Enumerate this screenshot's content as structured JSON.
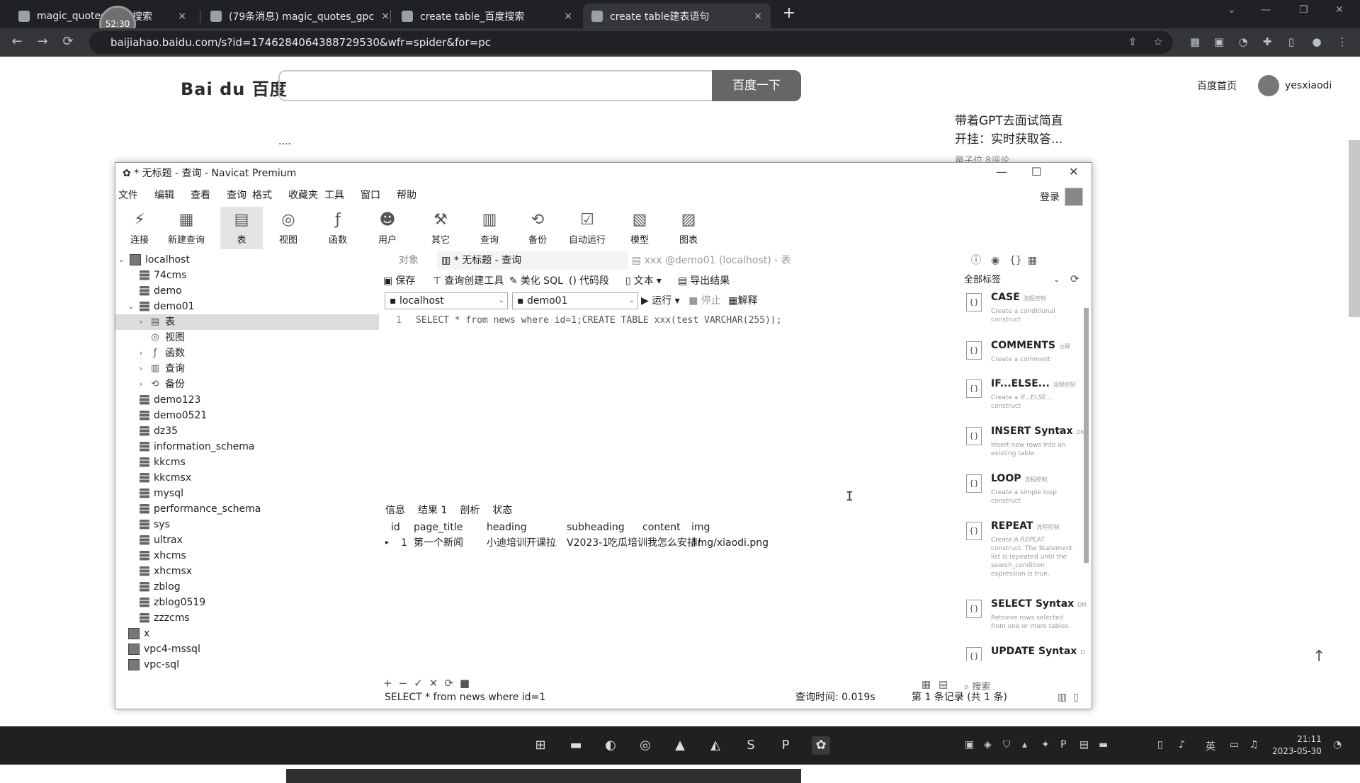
{
  "browser": {
    "tabs": [
      {
        "title": "magic_quotes",
        "close": "×"
      },
      {
        "title": "搜索",
        "close": "×"
      },
      {
        "title": "(79条消息) magic_quotes_gpc",
        "close": "×"
      },
      {
        "title": "create table_百度搜索",
        "close": "×"
      },
      {
        "title": "create table建表语句",
        "close": "×"
      }
    ],
    "new_tab": "+",
    "timer": "52:30",
    "url": "baijiahao.baidu.com/s?id=1746284064388729530&wfr=spider&for=pc",
    "back": "←",
    "forward": "→",
    "reload": "⟳"
  },
  "baidu": {
    "logo": "Bai du 百度",
    "search_value": "",
    "search_button": "百度一下",
    "home_link": "百度首页",
    "username": "yesxiaodi",
    "ellipsis": "....",
    "ad_line1": "带着GPT去面试简直",
    "ad_line2": "开挂：实时获取答...",
    "ad_meta": "量子位  8评论"
  },
  "navicat": {
    "title": "* 无标题 - 查询 - Navicat Premium",
    "menu": [
      "文件",
      "编辑",
      "查看",
      "查询",
      "格式",
      "收藏夹",
      "工具",
      "窗口",
      "帮助"
    ],
    "login": "登录",
    "toolbar": [
      {
        "label": "连接",
        "icon": "plug-icon"
      },
      {
        "label": "新建查询",
        "icon": "new-query-icon"
      },
      {
        "label": "表",
        "icon": "table-icon"
      },
      {
        "label": "视图",
        "icon": "view-icon"
      },
      {
        "label": "函数",
        "icon": "function-icon"
      },
      {
        "label": "用户",
        "icon": "user-icon"
      },
      {
        "label": "其它",
        "icon": "tools-icon"
      },
      {
        "label": "查询",
        "icon": "query-icon"
      },
      {
        "label": "备份",
        "icon": "backup-icon"
      },
      {
        "label": "自动运行",
        "icon": "auto-run-icon"
      },
      {
        "label": "模型",
        "icon": "model-icon"
      },
      {
        "label": "图表",
        "icon": "chart-icon"
      }
    ],
    "tree": {
      "root": "localhost",
      "dbs_before": [
        "74cms",
        "demo"
      ],
      "open_db": "demo01",
      "open_children": [
        "表",
        "视图",
        "函数",
        "查询",
        "备份"
      ],
      "dbs_after": [
        "demo123",
        "demo0521",
        "dz35",
        "information_schema",
        "kkcms",
        "kkcmsx",
        "mysql",
        "performance_schema",
        "sys",
        "ultrax",
        "xhcms",
        "xhcmsx",
        "zblog",
        "zblog0519",
        "zzzcms"
      ],
      "other_conns": [
        "x",
        "vpc4-mssql",
        "vpc-sql"
      ]
    },
    "editor_tabs": {
      "objects": "对象",
      "query_tab": "* 无标题 - 查询",
      "table_tab": "xxx @demo01 (localhost) - 表"
    },
    "sql_toolbar": {
      "save": "保存",
      "builder": "查询创建工具",
      "beautify": "美化 SQL",
      "snippet": "代码段",
      "text": "文本",
      "export": "导出结果"
    },
    "connection": "localhost",
    "database": "demo01",
    "run": "运行",
    "stop": "停止",
    "explain": "解释",
    "editor": {
      "line_no": "1",
      "code": "SELECT * from news where id=1;CREATE TABLE xxx(test VARCHAR(255));"
    },
    "result_tabs": [
      "信息",
      "结果 1",
      "剖析",
      "状态"
    ],
    "grid": {
      "columns": [
        "id",
        "page_title",
        "heading",
        "subheading",
        "content",
        "img"
      ],
      "rows": [
        [
          "1",
          "第一个新闻",
          "小迪培训开课拉",
          "V2023-1",
          "吃瓜培训我怎么安排！",
          "/img/xiaodi.png"
        ]
      ]
    },
    "grid_tools": [
      "+",
      "−",
      "✓",
      "✕",
      "⟳",
      "■"
    ],
    "status": {
      "sql": "SELECT * from news where id=1",
      "time": "查询时间: 0.019s",
      "records": "第 1 条记录 (共 1 条)"
    },
    "snippets": {
      "filter": "全部标签",
      "search": "搜索",
      "items": [
        {
          "name": "CASE",
          "tag": "流程控制",
          "desc": "Create a conditional construct"
        },
        {
          "name": "COMMENTS",
          "tag": "注释",
          "desc": "Create a comment"
        },
        {
          "name": "IF...ELSE...",
          "tag": "流程控制",
          "desc": "Create a IF...ELSE... construct"
        },
        {
          "name": "INSERT Syntax",
          "tag": "DM",
          "desc": "Insert new rows into an existing table"
        },
        {
          "name": "LOOP",
          "tag": "流程控制",
          "desc": "Create a simple loop construct"
        },
        {
          "name": "REPEAT",
          "tag": "流程控制",
          "desc": "Create A REPEAT construct. The Statement list is repeated until the search_condition expression is true."
        },
        {
          "name": "SELECT Syntax",
          "tag": "DM",
          "desc": "Retrieve rows selected from one or more tables"
        },
        {
          "name": "UPDATE Syntax",
          "tag": "D",
          "desc": ""
        }
      ]
    }
  },
  "taskbar": {
    "ime": "英",
    "time": "21:11",
    "date": "2023-05-30"
  }
}
